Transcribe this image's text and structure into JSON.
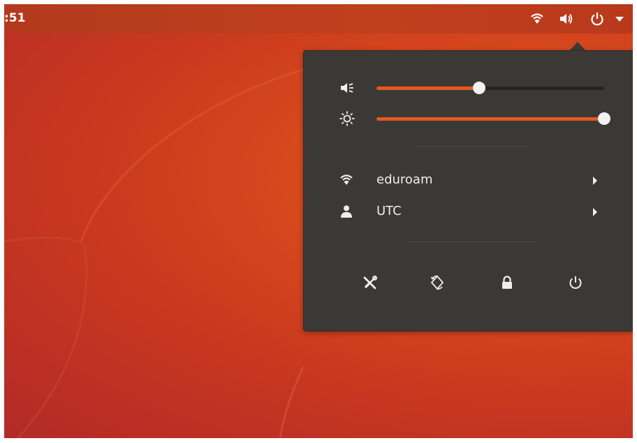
{
  "topbar": {
    "clock": ":51",
    "icons": [
      "wifi-icon",
      "volume-icon",
      "power-icon",
      "dropdown-arrow-icon"
    ]
  },
  "menu": {
    "volume": {
      "icon": "volume-icon",
      "level": 0.45
    },
    "brightness": {
      "icon": "brightness-icon",
      "level": 1.0
    },
    "wifi": {
      "icon": "wifi-icon",
      "label": "eduroam"
    },
    "user": {
      "icon": "user-icon",
      "label": "UTC"
    },
    "actions": [
      "settings-icon",
      "rotation-lock-icon",
      "lock-icon",
      "power-icon"
    ]
  },
  "colors": {
    "accent": "#e55a1c",
    "menu_bg": "#3b3936",
    "topbar_bg": "#c0401d",
    "text": "#eeeeec"
  }
}
